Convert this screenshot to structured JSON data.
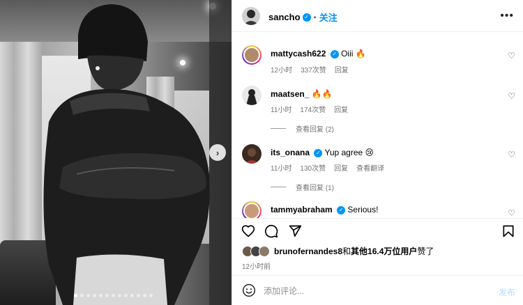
{
  "photo": {
    "next_glyph": "›",
    "dots_total": 13,
    "dots_active": 1
  },
  "header": {
    "username": "sancho",
    "follow_label": "关注",
    "more_glyph": "•••",
    "verified_glyph": "✓"
  },
  "comments": [
    {
      "username": "mattycash622",
      "text": "Oiii 🔥",
      "time": "12小时",
      "likes": "337次赞",
      "reply": "回复",
      "translate": ""
    },
    {
      "username": "maatsen_",
      "text": "🔥🔥",
      "time": "11小时",
      "likes": "174次赞",
      "reply": "回复",
      "translate": "",
      "view_replies": "查看回复 (2)"
    },
    {
      "username": "its_onana",
      "text": "Yup agree 😢",
      "time": "11小时",
      "likes": "130次赞",
      "reply": "回复",
      "translate": "查看翻译",
      "view_replies": "查看回复 (1)"
    },
    {
      "username": "tammyabraham",
      "text": "Serious!",
      "time": "",
      "likes": "",
      "reply": "",
      "translate": ""
    }
  ],
  "likes_line": {
    "user": "brunofernandes8",
    "joiner": "和",
    "others": "其他16.4万位用户",
    "suffix": "赞了"
  },
  "post_time": "12小时前",
  "compose": {
    "placeholder": "添加评论...",
    "post_label": "发布"
  },
  "colors": {
    "accent": "#0095f6",
    "meta_gray": "#737373",
    "post_disabled": "#b3dbff"
  },
  "icons": [
    "chevron-right-icon",
    "verified-icon",
    "more-icon",
    "heart-icon",
    "comment-icon",
    "share-icon",
    "bookmark-icon",
    "emoji-icon"
  ]
}
